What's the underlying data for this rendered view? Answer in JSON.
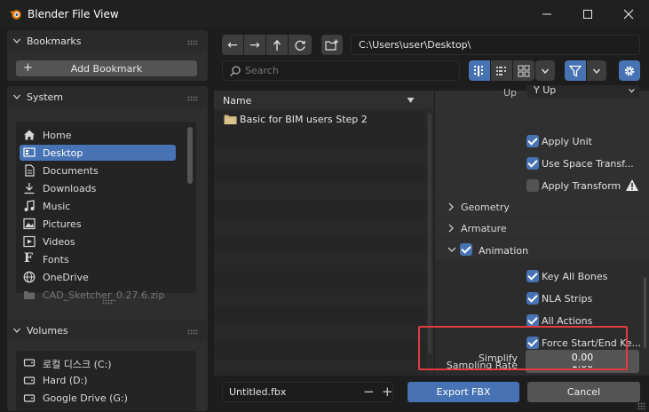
{
  "window": {
    "title": "Blender File View",
    "icons": [
      "blender-logo-icon",
      "minimize-icon",
      "maximize-icon",
      "close-icon"
    ]
  },
  "bookmarks": {
    "header": "Bookmarks",
    "add_label": "Add Bookmark"
  },
  "system": {
    "header": "System",
    "items": [
      {
        "label": "Home",
        "icon": "home-icon"
      },
      {
        "label": "Desktop",
        "icon": "desktop-icon",
        "selected": true
      },
      {
        "label": "Documents",
        "icon": "documents-icon"
      },
      {
        "label": "Downloads",
        "icon": "downloads-icon"
      },
      {
        "label": "Music",
        "icon": "music-icon"
      },
      {
        "label": "Pictures",
        "icon": "pictures-icon"
      },
      {
        "label": "Videos",
        "icon": "videos-icon"
      },
      {
        "label": "Fonts",
        "icon": "fonts-icon"
      },
      {
        "label": "OneDrive",
        "icon": "globe-icon"
      },
      {
        "label": "CAD_Sketcher_0.27.6.zip",
        "icon": "folder-icon"
      }
    ]
  },
  "volumes": {
    "header": "Volumes",
    "items": [
      {
        "label": "로컬 디스크 (C:)",
        "icon": "drive-icon"
      },
      {
        "label": "Hard (D:)",
        "icon": "drive-icon"
      },
      {
        "label": "Google Drive (G:)",
        "icon": "drive-icon"
      }
    ]
  },
  "toolbar": {
    "path": "C:\\Users\\user\\Desktop\\",
    "search_placeholder": "Search"
  },
  "filelist": {
    "column_name": "Name",
    "files": [
      {
        "name": "Basic for BIM users Step 2",
        "type": "folder"
      }
    ]
  },
  "props": {
    "up_value": "Y Up",
    "up_label": "Up",
    "checks": [
      {
        "label": "Apply Unit",
        "checked": true
      },
      {
        "label": "Use Space Transf...",
        "checked": true
      },
      {
        "label": "Apply Transform",
        "checked": false
      }
    ],
    "sections": {
      "geometry": "Geometry",
      "armature": "Armature",
      "animation": "Animation"
    },
    "anim_checks": [
      {
        "label": "Key All Bones",
        "checked": true
      },
      {
        "label": "NLA Strips",
        "checked": true
      },
      {
        "label": "All Actions",
        "checked": true
      },
      {
        "label": "Force Start/End Ke...",
        "checked": true
      }
    ],
    "sampling_rate_label": "Sampling Rate",
    "sampling_rate_value": "1.00",
    "simplify_label": "Simplify",
    "simplify_value": "0.00"
  },
  "footer": {
    "filename": "Untitled.fbx",
    "export_label": "Export FBX",
    "cancel_label": "Cancel"
  },
  "colors": {
    "accent": "#4772b3",
    "highlight_box": "#e23c3c"
  }
}
